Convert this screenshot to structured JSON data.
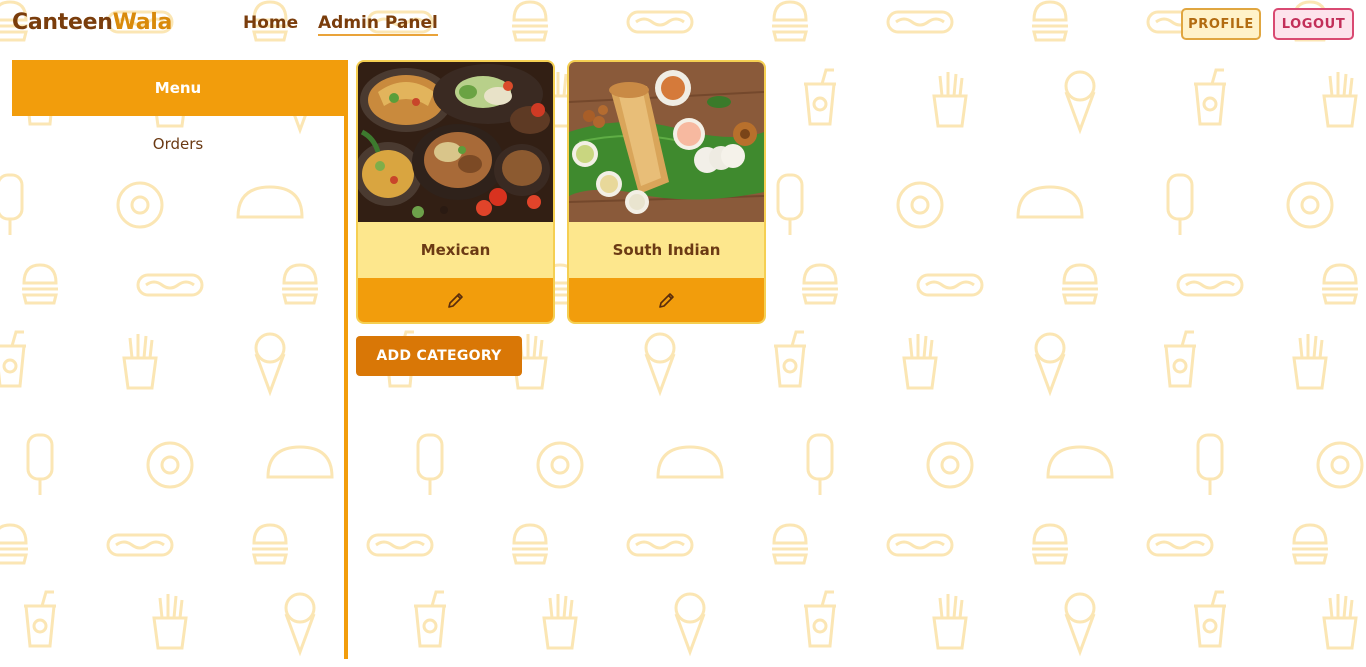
{
  "brand": {
    "part1": "Canteen",
    "part2": "Wala"
  },
  "nav": {
    "home": "Home",
    "admin_panel": "Admin Panel"
  },
  "header_buttons": {
    "profile": "PROFILE",
    "logout": "LOGOUT"
  },
  "sidebar": {
    "menu": "Menu",
    "orders": "Orders"
  },
  "categories": [
    {
      "name": "Mexican",
      "edit_icon": "pencil-icon"
    },
    {
      "name": "South Indian",
      "edit_icon": "pencil-icon"
    }
  ],
  "actions": {
    "add_category": "ADD CATEGORY"
  },
  "colors": {
    "brand_dark": "#7a3d0c",
    "brand_accent": "#d98a0b",
    "primary_orange": "#f29d0c",
    "card_yellow": "#fde78d",
    "logout_red": "#c22e59",
    "pattern": "#fbe6b4"
  }
}
